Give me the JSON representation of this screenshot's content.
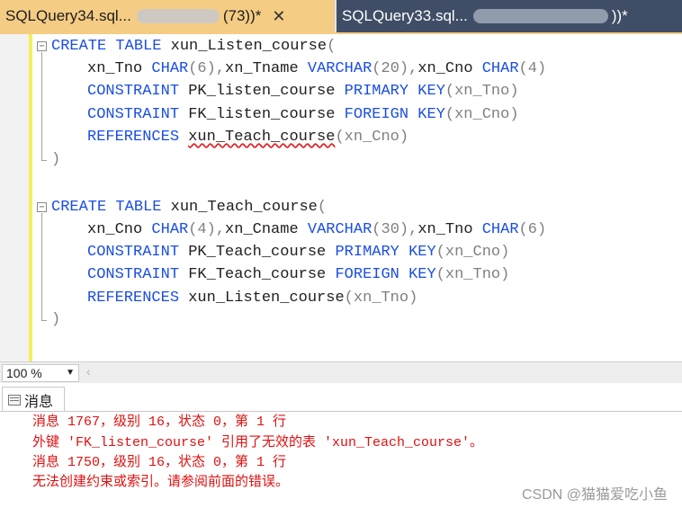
{
  "tabs": [
    {
      "title_start": "SQLQuery34.sql...",
      "title_end": "(73))*",
      "close": "✕"
    },
    {
      "title_start": "SQLQuery33.sql...",
      "title_end": "))*"
    }
  ],
  "code": {
    "block1": {
      "line1": {
        "kw1": "CREATE",
        "kw2": "TABLE",
        "name": "xun_Listen_course",
        "paren": "("
      },
      "line2": {
        "c1": "xn_Tno",
        "t1": "CHAR",
        "p1": "(6)",
        "s1": ",",
        "c2": "xn_Tname",
        "t2": "VARCHAR",
        "p2": "(20)",
        "s2": ",",
        "c3": "xn_Cno",
        "t3": "CHAR",
        "p3": "(4)"
      },
      "line3": {
        "kw1": "CONSTRAINT",
        "name": "PK_listen_course",
        "kw2": "PRIMARY",
        "kw3": "KEY",
        "arg": "(xn_Tno)"
      },
      "line4": {
        "kw1": "CONSTRAINT",
        "name": "FK_listen_course",
        "kw2": "FOREIGN",
        "kw3": "KEY",
        "arg": "(xn_Cno)"
      },
      "line5": {
        "kw1": "REFERENCES",
        "name": "xun_Teach_course",
        "arg": "(xn_Cno)"
      },
      "close": ")"
    },
    "block2": {
      "line1": {
        "kw1": "CREATE",
        "kw2": "TABLE",
        "name": "xun_Teach_course",
        "paren": "("
      },
      "line2": {
        "c1": "xn_Cno",
        "t1": "CHAR",
        "p1": "(4)",
        "s1": ",",
        "c2": "xn_Cname",
        "t2": "VARCHAR",
        "p2": "(30)",
        "s2": ",",
        "c3": "xn_Tno",
        "t3": "CHAR",
        "p3": "(6)"
      },
      "line3": {
        "kw1": "CONSTRAINT",
        "name": "PK_Teach_course",
        "kw2": "PRIMARY",
        "kw3": "KEY",
        "arg": "(xn_Cno)"
      },
      "line4": {
        "kw1": "CONSTRAINT",
        "name": "FK_Teach_course",
        "kw2": "FOREIGN",
        "kw3": "KEY",
        "arg": "(xn_Tno)"
      },
      "line5": {
        "kw1": "REFERENCES",
        "name": "xun_Listen_course",
        "arg": "(xn_Tno)"
      },
      "close": ")"
    }
  },
  "zoom": {
    "value": "100 %"
  },
  "messages": {
    "tab_label": "消息",
    "lines": [
      "消息 1767，级别 16，状态 0，第 1 行",
      "外键 'FK_listen_course' 引用了无效的表 'xun_Teach_course'。",
      "消息 1750，级别 16，状态 0，第 1 行",
      "无法创建约束或索引。请参阅前面的错误。"
    ]
  },
  "watermark": "CSDN @猫猫爱吃小鱼",
  "colors": {
    "keyword": "#1a4ee6",
    "error": "#e01010",
    "active_tab": "#f5cc84",
    "inactive_tab": "#3f4e66"
  }
}
